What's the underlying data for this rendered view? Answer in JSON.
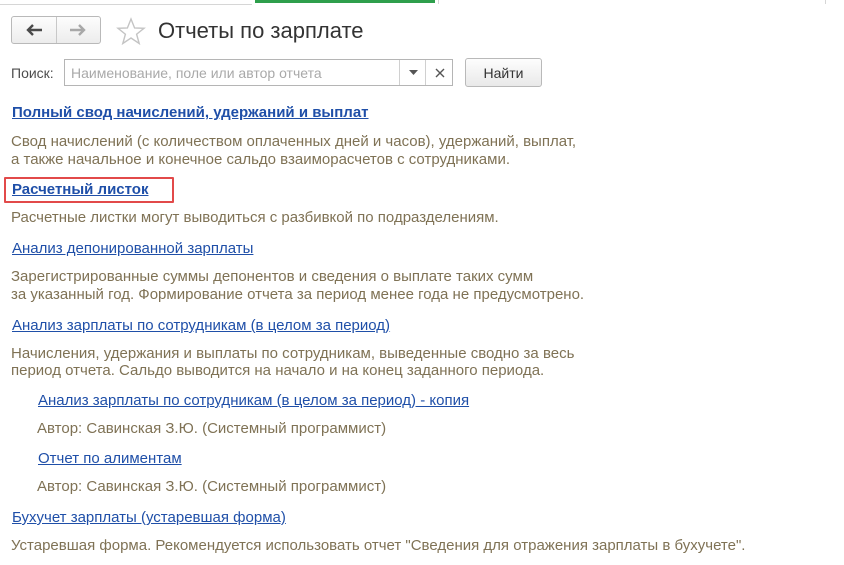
{
  "header": {
    "title": "Отчеты по зарплате",
    "back_icon": "arrow-left-icon",
    "forward_icon": "arrow-right-icon",
    "favorite_icon": "star-icon"
  },
  "search": {
    "label": "Поиск:",
    "placeholder": "Наименование, поле или автор отчета",
    "value": "",
    "find_button": "Найти"
  },
  "colors": {
    "link": "#1f4fa8",
    "description": "#7f7255",
    "highlight": "#e24a4a",
    "active_tab": "#2e9f4c"
  },
  "reports": [
    {
      "title": "Полный свод начислений, удержаний и выплат",
      "desc_lines": [
        "Свод начислений (с количеством оплаченных дней и часов), удержаний, выплат,",
        "а также начальное и конечное сальдо взаиморасчетов с сотрудниками."
      ]
    },
    {
      "title": "Расчетный листок",
      "desc_lines": [
        "Расчетные листки могут выводиться с разбивкой по подразделениям."
      ]
    },
    {
      "title": "Анализ депонированной зарплаты",
      "desc_lines": [
        "Зарегистрированные суммы депонентов и сведения о выплате таких сумм",
        "за указанный год. Формирование отчета за период менее года не предусмотрено."
      ]
    },
    {
      "title": "Анализ зарплаты по сотрудникам (в целом за период)",
      "desc_lines": [
        "Начисления, удержания и выплаты по сотрудникам, выведенные сводно за весь",
        "период отчета. Сальдо выводится на начало и на конец заданного периода."
      ]
    },
    {
      "title": "Анализ зарплаты по сотрудникам (в целом за период) - копия",
      "desc_lines": [
        "Автор: Савинская З.Ю. (Системный программист)"
      ]
    },
    {
      "title": "Отчет по алиментам",
      "desc_lines": [
        "Автор: Савинская З.Ю. (Системный программист)"
      ]
    },
    {
      "title": "Бухучет зарплаты (устаревшая форма)",
      "desc_lines": [
        "Устаревшая форма. Рекомендуется использовать отчет \"Сведения для отражения зарплаты в бухучете\"."
      ]
    }
  ]
}
